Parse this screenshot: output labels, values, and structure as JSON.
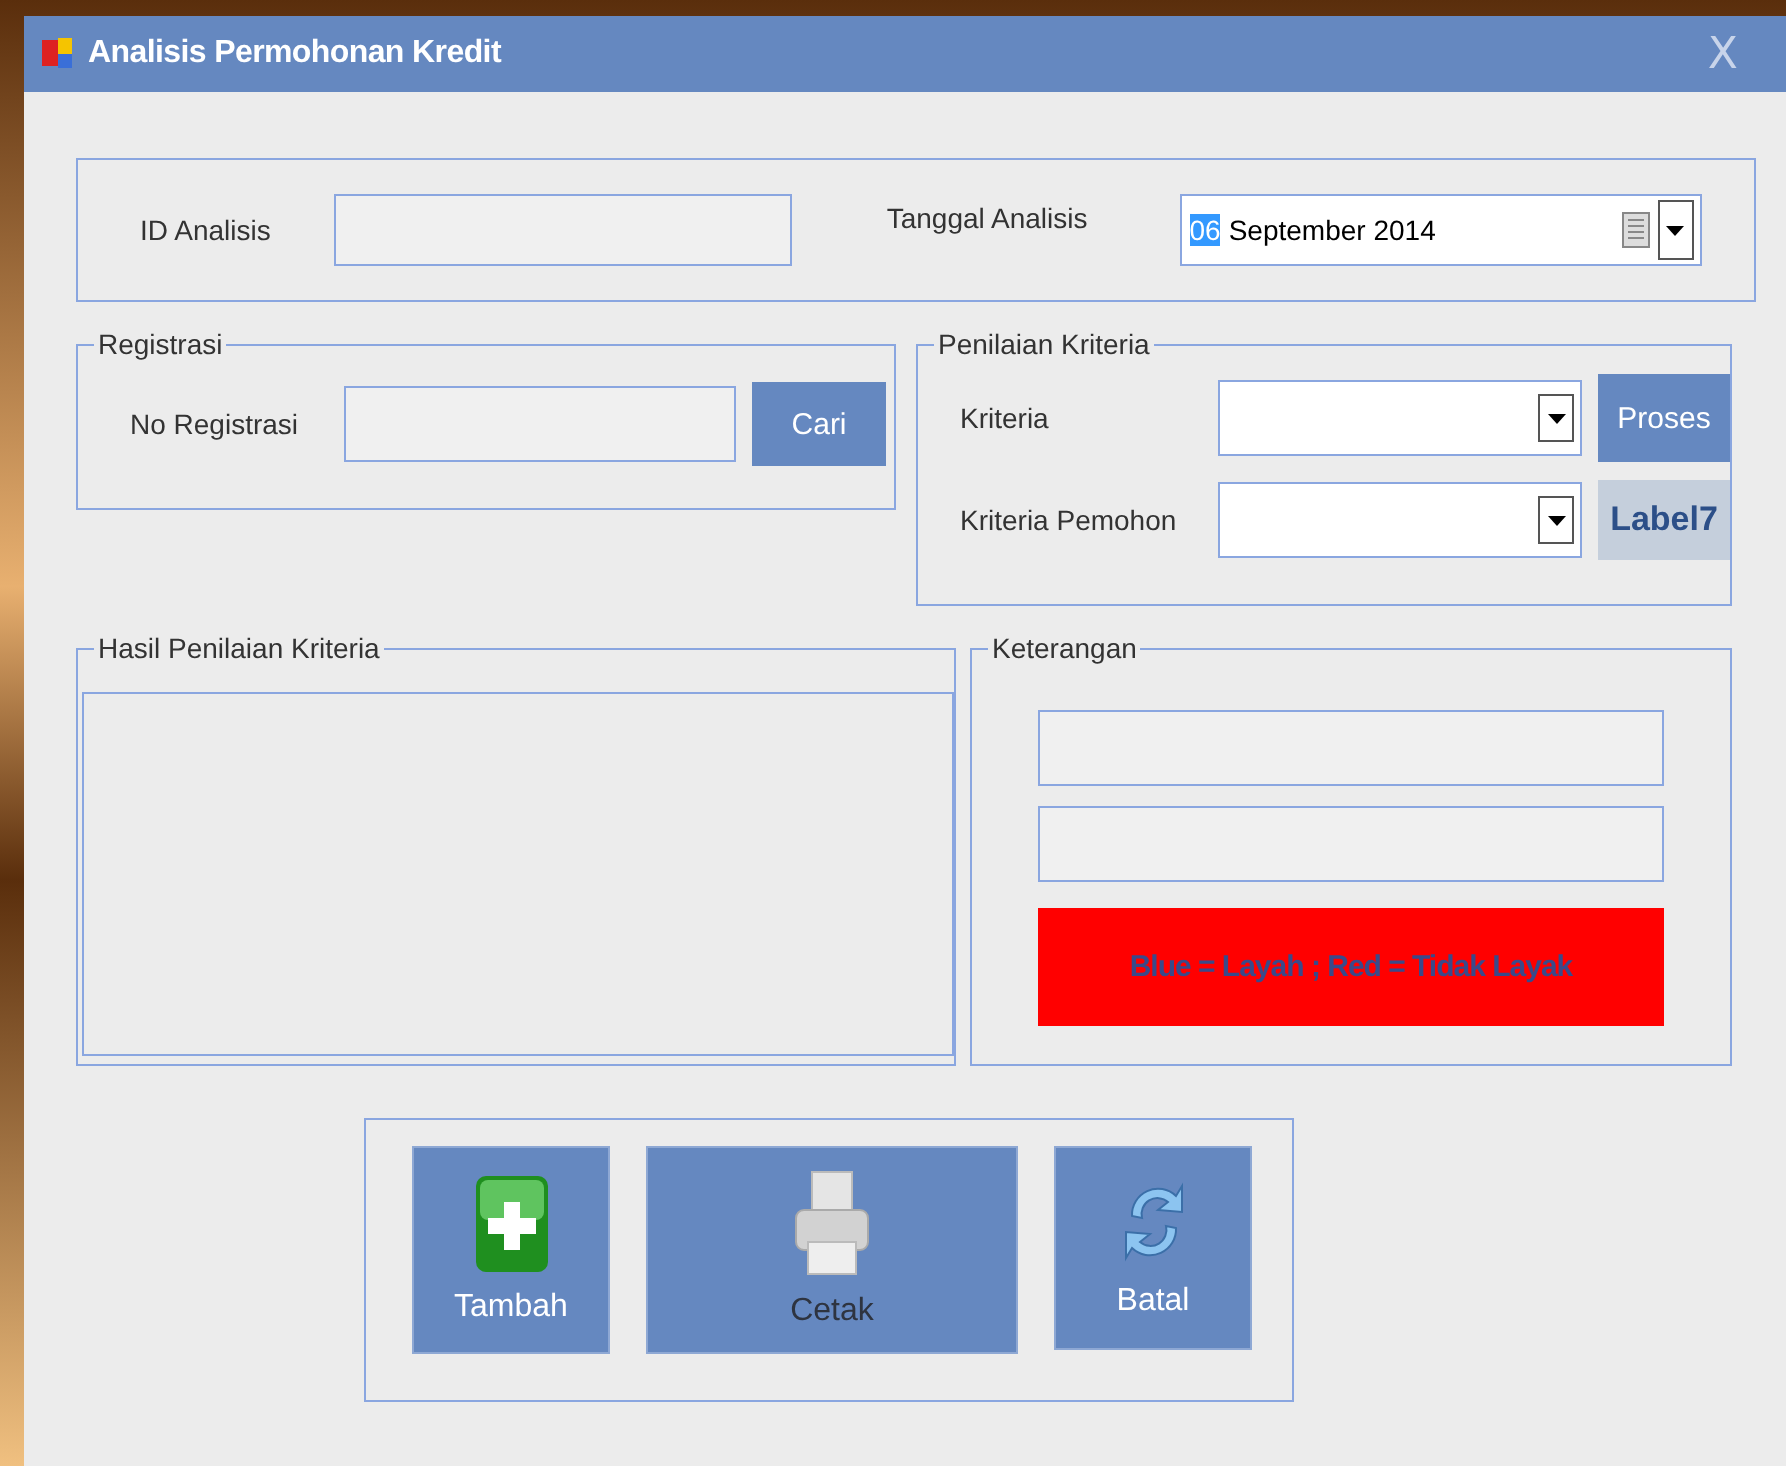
{
  "window": {
    "title": "Analisis Permohonan Kredit",
    "close": "X"
  },
  "analisis": {
    "id_label": "ID Analisis",
    "date_label": "Tanggal Analisis",
    "date_day": "06",
    "date_rest": "September 2014"
  },
  "registrasi": {
    "legend": "Registrasi",
    "label": "No Registrasi",
    "button": "Cari"
  },
  "penilaian": {
    "legend": "Penilaian Kriteria",
    "rows": [
      {
        "label": "Kriteria"
      },
      {
        "label": "Kriteria Pemohon"
      }
    ],
    "button": "Proses",
    "label7": "Label7"
  },
  "hasil": {
    "legend": "Hasil Penilaian Kriteria"
  },
  "keterangan": {
    "legend": "Keterangan",
    "legend_text": "Blue = Layah ; Red = Tidak Layak"
  },
  "actions": [
    {
      "kind": "add",
      "label": "Tambah",
      "disabled": false
    },
    {
      "kind": "print",
      "label": "Cetak",
      "disabled": true
    },
    {
      "kind": "refresh",
      "label": "Batal",
      "disabled": false
    }
  ]
}
